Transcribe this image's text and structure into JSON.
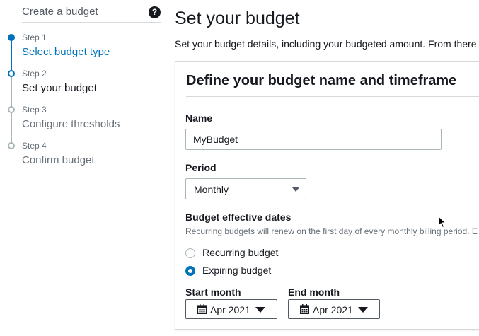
{
  "sidebar": {
    "title": "Create a budget",
    "help_icon": "?",
    "steps": [
      {
        "label": "Step 1",
        "name": "Select budget type",
        "state": "complete"
      },
      {
        "label": "Step 2",
        "name": "Set your budget",
        "state": "current"
      },
      {
        "label": "Step 3",
        "name": "Configure thresholds",
        "state": "upcoming"
      },
      {
        "label": "Step 4",
        "name": "Confirm budget",
        "state": "upcoming"
      }
    ]
  },
  "main": {
    "title": "Set your budget",
    "description": "Set your budget details, including your budgeted amount. From there",
    "panel": {
      "title": "Define your budget name and timeframe",
      "name_field": {
        "label": "Name",
        "value": "MyBudget"
      },
      "period_field": {
        "label": "Period",
        "value": "Monthly"
      },
      "effective_dates": {
        "label": "Budget effective dates",
        "hint": "Recurring budgets will renew on the first day of every monthly billing period. E",
        "options": [
          {
            "label": "Recurring budget",
            "checked": false
          },
          {
            "label": "Expiring budget",
            "checked": true
          }
        ]
      },
      "start_month": {
        "label": "Start month",
        "value": "Apr 2021"
      },
      "end_month": {
        "label": "End month",
        "value": "Apr 2021"
      }
    }
  },
  "colors": {
    "accent": "#0073bb",
    "step_active_line": "#0073bb",
    "step_inactive": "#aab7b8"
  },
  "icons": [
    "help-icon",
    "caret-down-icon",
    "calendar-icon",
    "mouse-cursor-icon"
  ]
}
